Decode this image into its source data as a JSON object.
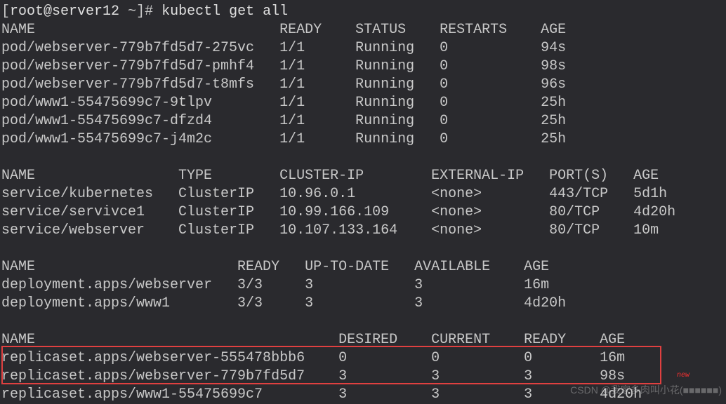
{
  "prompt": {
    "bracket_open": "[",
    "user_host": "root@server12",
    "path": " ~",
    "bracket_close": "]#",
    "command": " kubectl get all"
  },
  "pods": {
    "header": {
      "name": "NAME",
      "ready": "READY",
      "status": "STATUS",
      "restarts": "RESTARTS",
      "age": "AGE"
    },
    "rows": [
      {
        "name": "pod/webserver-779b7fd5d7-275vc",
        "ready": "1/1",
        "status": "Running",
        "restarts": "0",
        "age": "94s"
      },
      {
        "name": "pod/webserver-779b7fd5d7-pmhf4",
        "ready": "1/1",
        "status": "Running",
        "restarts": "0",
        "age": "98s"
      },
      {
        "name": "pod/webserver-779b7fd5d7-t8mfs",
        "ready": "1/1",
        "status": "Running",
        "restarts": "0",
        "age": "96s"
      },
      {
        "name": "pod/www1-55475699c7-9tlpv",
        "ready": "1/1",
        "status": "Running",
        "restarts": "0",
        "age": "25h"
      },
      {
        "name": "pod/www1-55475699c7-dfzd4",
        "ready": "1/1",
        "status": "Running",
        "restarts": "0",
        "age": "25h"
      },
      {
        "name": "pod/www1-55475699c7-j4m2c",
        "ready": "1/1",
        "status": "Running",
        "restarts": "0",
        "age": "25h"
      }
    ]
  },
  "services": {
    "header": {
      "name": "NAME",
      "type": "TYPE",
      "clusterip": "CLUSTER-IP",
      "externalip": "EXTERNAL-IP",
      "ports": "PORT(S)",
      "age": "AGE"
    },
    "rows": [
      {
        "name": "service/kubernetes",
        "type": "ClusterIP",
        "clusterip": "10.96.0.1",
        "externalip": "<none>",
        "ports": "443/TCP",
        "age": "5d1h"
      },
      {
        "name": "service/servivce1",
        "type": "ClusterIP",
        "clusterip": "10.99.166.109",
        "externalip": "<none>",
        "ports": "80/TCP",
        "age": "4d20h"
      },
      {
        "name": "service/webserver",
        "type": "ClusterIP",
        "clusterip": "10.107.133.164",
        "externalip": "<none>",
        "ports": "80/TCP",
        "age": "10m"
      }
    ]
  },
  "deployments": {
    "header": {
      "name": "NAME",
      "ready": "READY",
      "uptodate": "UP-TO-DATE",
      "available": "AVAILABLE",
      "age": "AGE"
    },
    "rows": [
      {
        "name": "deployment.apps/webserver",
        "ready": "3/3",
        "uptodate": "3",
        "available": "3",
        "age": "16m"
      },
      {
        "name": "deployment.apps/www1",
        "ready": "3/3",
        "uptodate": "3",
        "available": "3",
        "age": "4d20h"
      }
    ]
  },
  "replicasets": {
    "header": {
      "name": "NAME",
      "desired": "DESIRED",
      "current": "CURRENT",
      "ready": "READY",
      "age": "AGE"
    },
    "rows": [
      {
        "name": "replicaset.apps/webserver-555478bbb6",
        "desired": "0",
        "current": "0",
        "ready": "0",
        "age": "16m"
      },
      {
        "name": "replicaset.apps/webserver-779b7fd5d7",
        "desired": "3",
        "current": "3",
        "ready": "3",
        "age": "98s"
      },
      {
        "name": "replicaset.apps/www1-55475699c7",
        "desired": "3",
        "current": "3",
        "ready": "3",
        "age": "4d20h"
      }
    ]
  },
  "watermark": "CSDN @我家多肉叫小花(■■■■■■)",
  "new_badge": "new"
}
